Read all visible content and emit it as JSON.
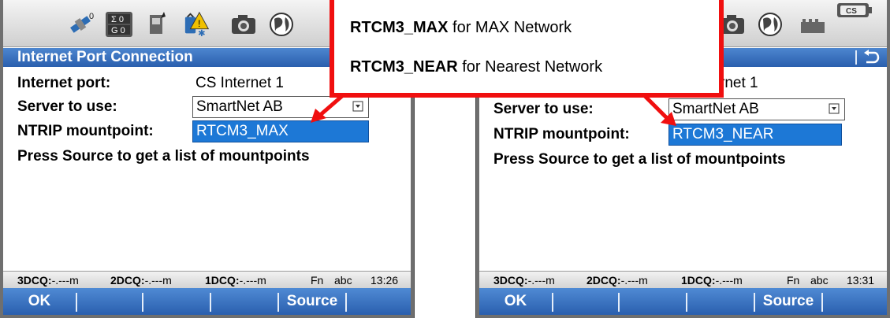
{
  "callout": {
    "line1_bold": "RTCM3_MAX",
    "line1_rest": " for MAX Network",
    "line2_bold": "RTCM3_NEAR",
    "line2_rest": " for Nearest Network"
  },
  "icons": {
    "gps_count": "0",
    "sigma_top": "Σ 0",
    "sigma_bottom": "G 0",
    "cs_badge": "CS"
  },
  "left": {
    "title": "Internet Port Connection",
    "internet_port_label": "Internet port:",
    "internet_port_value": "CS Internet 1",
    "server_label": "Server to use:",
    "server_value": "SmartNet AB",
    "mountpoint_label": "NTRIP mountpoint:",
    "mountpoint_value": "RTCM3_MAX",
    "hint": "Press Source to get a list of mountpoints",
    "info": {
      "q3_label": "3DCQ:",
      "q3_value": "-.---m",
      "q2_label": "2DCQ:",
      "q2_value": "-.---m",
      "q1_label": "1DCQ:",
      "q1_value": "-.---m",
      "fn": "Fn",
      "abc": "abc",
      "time": "13:26"
    },
    "softkeys": {
      "ok": "OK",
      "source": "Source"
    }
  },
  "right": {
    "internet_port_value_partial": "rnet 1",
    "server_label": "Server to use:",
    "server_value": "SmartNet AB",
    "mountpoint_label": "NTRIP mountpoint:",
    "mountpoint_value": "RTCM3_NEAR",
    "hint": "Press Source to get a list of mountpoints",
    "info": {
      "q3_label": "3DCQ:",
      "q3_value": "-.---m",
      "q2_label": "2DCQ:",
      "q2_value": "-.---m",
      "q1_label": "1DCQ:",
      "q1_value": "-.---m",
      "fn": "Fn",
      "abc": "abc",
      "time": "13:31"
    },
    "softkeys": {
      "ok": "OK",
      "source": "Source"
    }
  },
  "colors": {
    "title_blue": "#2a5fae",
    "selection_blue": "#1d78d6",
    "callout_red": "#f00f0f"
  }
}
